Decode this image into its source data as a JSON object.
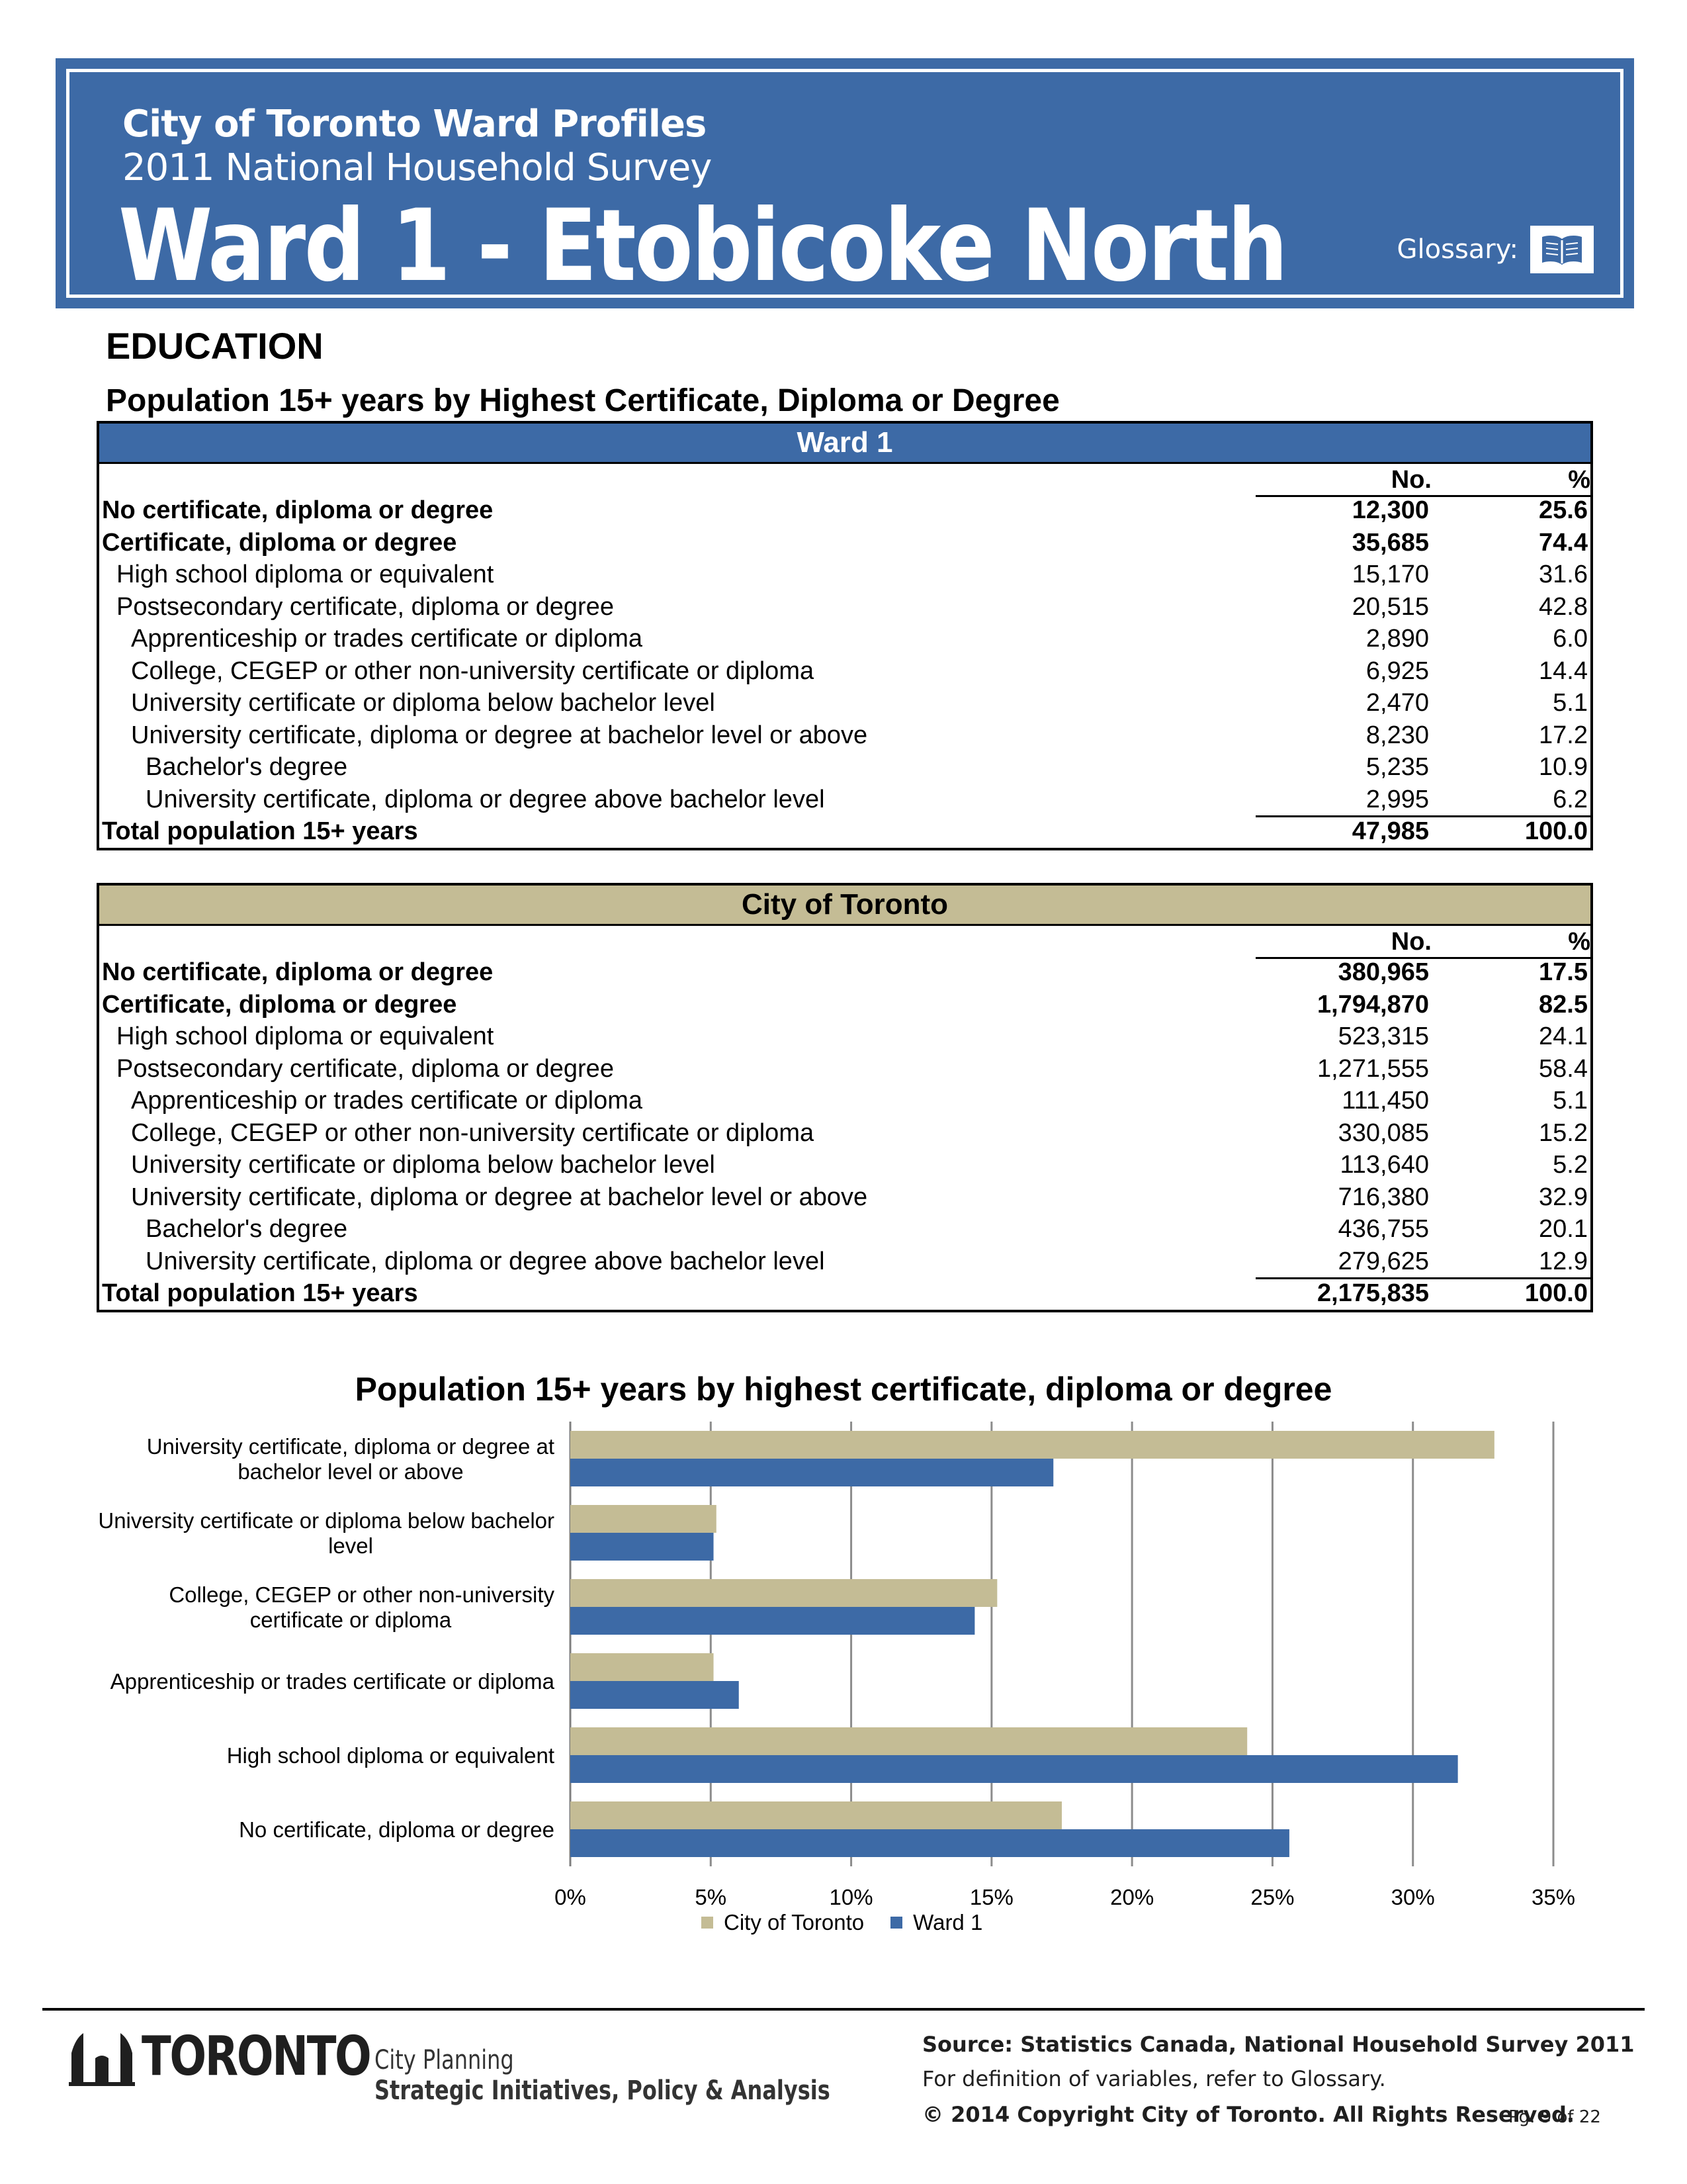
{
  "banner": {
    "line1": "City of Toronto Ward Profiles",
    "line2": "2011 National Household Survey",
    "ward_title": "Ward 1 - Etobicoke North",
    "glossary_label": "Glossary:",
    "glossary_icon": "book-icon",
    "color": "#3d6aa6"
  },
  "section_title": "EDUCATION",
  "table_title": "Population 15+ years by Highest Certificate, Diploma or Degree",
  "col_no": "No.",
  "col_pct": "%",
  "ward_table": {
    "header": "Ward 1",
    "rows": [
      {
        "label": "No certificate, diploma or degree",
        "no": "12,300",
        "pct": "25.6"
      },
      {
        "label": "Certificate, diploma or degree",
        "no": "35,685",
        "pct": "74.4"
      },
      {
        "label": "High school diploma or equivalent",
        "no": "15,170",
        "pct": "31.6"
      },
      {
        "label": "Postsecondary certificate, diploma or degree",
        "no": "20,515",
        "pct": "42.8"
      },
      {
        "label": "Apprenticeship or trades certificate or diploma",
        "no": "2,890",
        "pct": "6.0"
      },
      {
        "label": "College, CEGEP or other non-university certificate or diploma",
        "no": "6,925",
        "pct": "14.4"
      },
      {
        "label": "University certificate or diploma below bachelor level",
        "no": "2,470",
        "pct": "5.1"
      },
      {
        "label": "University certificate, diploma or degree at bachelor level or above",
        "no": "8,230",
        "pct": "17.2"
      },
      {
        "label": "Bachelor's degree",
        "no": "5,235",
        "pct": "10.9"
      },
      {
        "label": "University certificate, diploma or degree above bachelor level",
        "no": "2,995",
        "pct": "6.2"
      },
      {
        "label": "Total population 15+ years",
        "no": "47,985",
        "pct": "100.0"
      }
    ]
  },
  "city_table": {
    "header": "City of Toronto",
    "rows": [
      {
        "label": "No certificate, diploma or degree",
        "no": "380,965",
        "pct": "17.5"
      },
      {
        "label": "Certificate, diploma or degree",
        "no": "1,794,870",
        "pct": "82.5"
      },
      {
        "label": "High school diploma or equivalent",
        "no": "523,315",
        "pct": "24.1"
      },
      {
        "label": "Postsecondary certificate, diploma or degree",
        "no": "1,271,555",
        "pct": "58.4"
      },
      {
        "label": "Apprenticeship or trades certificate or diploma",
        "no": "111,450",
        "pct": "5.1"
      },
      {
        "label": "College, CEGEP or other non-university certificate or diploma",
        "no": "330,085",
        "pct": "15.2"
      },
      {
        "label": "University certificate or diploma below bachelor level",
        "no": "113,640",
        "pct": "5.2"
      },
      {
        "label": "University certificate, diploma or degree at bachelor level or above",
        "no": "716,380",
        "pct": "32.9"
      },
      {
        "label": "Bachelor's degree",
        "no": "436,755",
        "pct": "20.1"
      },
      {
        "label": "University certificate, diploma or degree above bachelor level",
        "no": "279,625",
        "pct": "12.9"
      },
      {
        "label": "Total population 15+ years",
        "no": "2,175,835",
        "pct": "100.0"
      }
    ]
  },
  "chart_data": {
    "type": "bar",
    "orientation": "horizontal",
    "title": "Population 15+ years by highest certificate, diploma or degree",
    "categories": [
      [
        "University certificate, diploma or degree at",
        "bachelor level or above"
      ],
      [
        "University certificate or diploma below bachelor",
        "level"
      ],
      [
        "College, CEGEP or other non-university",
        "certificate or diploma"
      ],
      [
        "Apprenticeship or trades certificate or diploma"
      ],
      [
        "High school diploma or equivalent"
      ],
      [
        "No certificate, diploma or degree"
      ]
    ],
    "series": [
      {
        "name": "City of Toronto",
        "color": "#c4bc95",
        "values": [
          32.9,
          5.2,
          15.2,
          5.1,
          24.1,
          17.5
        ]
      },
      {
        "name": "Ward 1",
        "color": "#3d6aa6",
        "values": [
          17.2,
          5.1,
          14.4,
          6.0,
          31.6,
          25.6
        ]
      }
    ],
    "xlim": [
      0,
      35
    ],
    "xticks": [
      0,
      5,
      10,
      15,
      20,
      25,
      30,
      35
    ],
    "tick_suffix": "%",
    "grid": "vertical",
    "legend": "bottom"
  },
  "footer": {
    "logo_word": "TORONTO",
    "logo_icon": "city-hall-icon",
    "city_planning": "City Planning",
    "division": "Strategic Initiatives, Policy & Analysis",
    "source": "Source: Statistics Canada, National Household Survey 2011",
    "definition": "For definition of variables, refer to Glossary.",
    "copyright": "© 2014 Copyright City of Toronto.  All Rights Reserved.",
    "page": "Pg. 9 of 22"
  }
}
